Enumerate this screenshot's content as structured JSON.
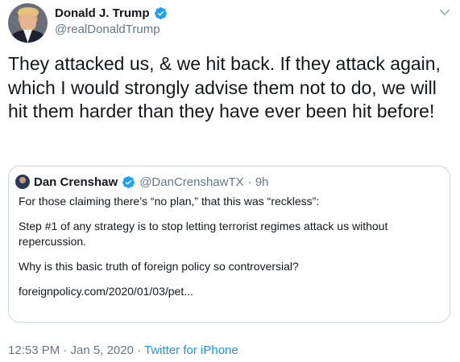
{
  "tweet": {
    "author_name": "Donald J. Trump",
    "author_handle": "@realDonaldTrump",
    "text": "They attacked us, & we hit back. If they attack again, which I would strongly advise them not to do, we will hit them harder than they have ever been hit before!",
    "timestamp": "12:53 PM · Jan 5, 2020",
    "separator": " · ",
    "source": "Twitter for iPhone"
  },
  "quoted_tweet": {
    "author_name": "Dan Crenshaw",
    "author_handle": "@DanCrenshawTX",
    "age": "· 9h",
    "paragraphs": [
      "For those claiming there’s “no plan,” that this was “reckless”:",
      "Step #1 of any strategy is to stop letting terrorist regimes attack us without repercussion.",
      "Why is this basic truth of foreign policy so controversial?",
      "foreignpolicy.com/2020/01/03/pet..."
    ]
  },
  "colors": {
    "text": "#14171a",
    "secondary": "#657786",
    "link": "#1b95e0",
    "verified": "#1da1f2",
    "border": "#ccd6dd"
  },
  "icons": [
    "verified-badge-icon",
    "chevron-down-icon"
  ]
}
